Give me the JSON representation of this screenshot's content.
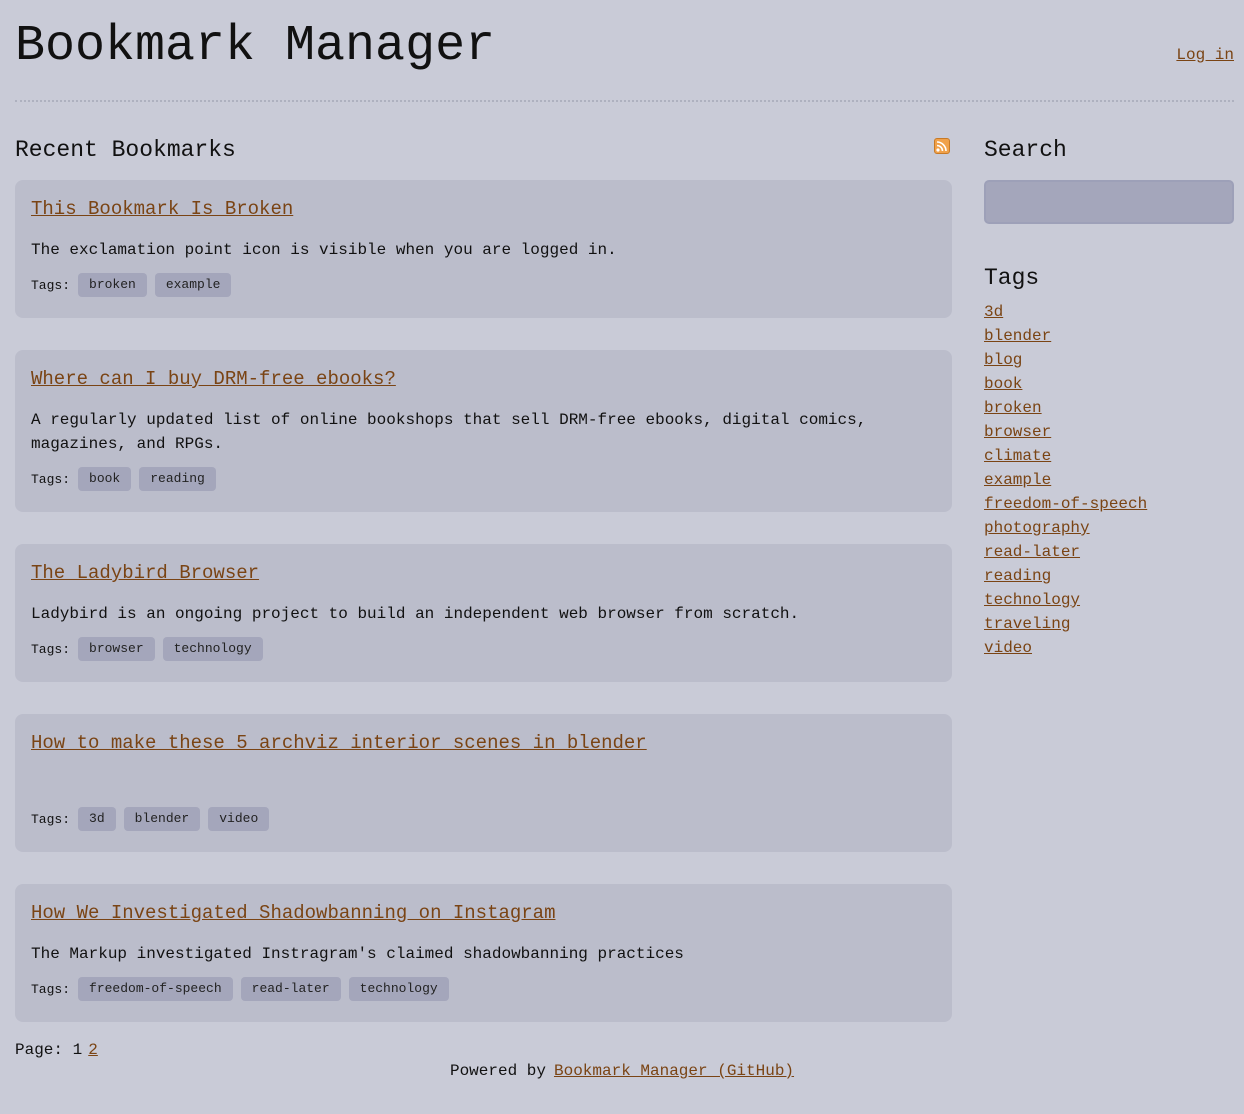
{
  "header": {
    "title": "Bookmark Manager",
    "login_label": "Log in"
  },
  "main": {
    "section_title": "Recent Bookmarks",
    "rss_icon": "rss-feed-icon",
    "tags_label": "Tags:",
    "bookmarks": [
      {
        "title": "This Bookmark Is Broken",
        "description": "The exclamation point icon is visible when you are logged in.",
        "tags": [
          "broken",
          "example"
        ]
      },
      {
        "title": "Where can I buy DRM-free ebooks?",
        "description": "A regularly updated list of online bookshops that sell DRM-free ebooks, digital comics, magazines, and RPGs.",
        "tags": [
          "book",
          "reading"
        ]
      },
      {
        "title": "The Ladybird Browser",
        "description": "Ladybird is an ongoing project to build an independent web browser from scratch.",
        "tags": [
          "browser",
          "technology"
        ]
      },
      {
        "title": "How to make these 5 archviz interior scenes in blender",
        "description": "",
        "tags": [
          "3d",
          "blender",
          "video"
        ]
      },
      {
        "title": "How We Investigated Shadowbanning on Instagram",
        "description": "The Markup investigated Instragram's claimed shadowbanning practices",
        "tags": [
          "freedom-of-speech",
          "read-later",
          "technology"
        ]
      }
    ],
    "pagination": {
      "label": "Page:",
      "current": "1",
      "next": "2"
    }
  },
  "sidebar": {
    "search_title": "Search",
    "search_value": "",
    "tags_title": "Tags",
    "tags": [
      "3d",
      "blender",
      "blog",
      "book",
      "broken",
      "browser",
      "climate",
      "example",
      "freedom-of-speech",
      "photography",
      "read-later",
      "reading",
      "technology",
      "traveling",
      "video"
    ]
  },
  "footer": {
    "powered_by": "Powered by",
    "link_label": "Bookmark Manager (GitHub)"
  },
  "colors": {
    "background": "#c9cbd7",
    "card": "#bbbdcb",
    "tag_chip": "#a4a6bb",
    "link": "#7a4414",
    "rss": "#f0a14a"
  }
}
